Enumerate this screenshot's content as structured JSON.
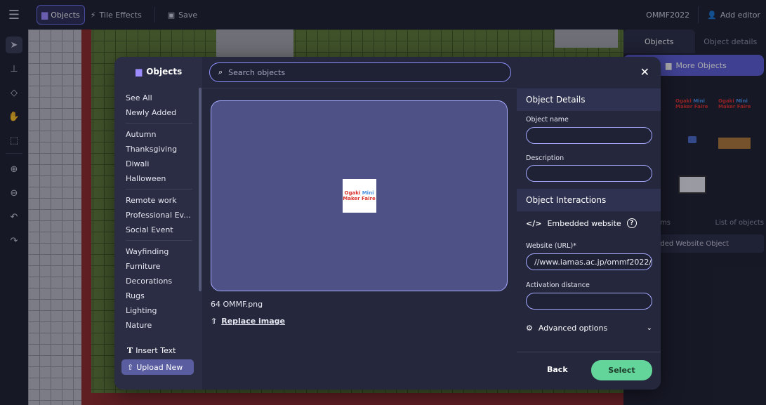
{
  "topbar": {
    "objects_label": "Objects",
    "tile_effects_label": "Tile Effects",
    "save_label": "Save",
    "room_name": "OMMF2022",
    "add_editor_label": "Add editor"
  },
  "right_panel": {
    "tabs": [
      "Objects",
      "Object details"
    ],
    "more_objects_label": "More Objects",
    "thumb_logo_line1a": "Ogaki ",
    "thumb_logo_line1b": "Mini",
    "thumb_logo_line2": "Maker Faire",
    "lower_tabs": [
      "ms",
      "List of objects"
    ],
    "list_item": "dded Website Object"
  },
  "modal": {
    "title": "Objects",
    "categories": [
      [
        "See All",
        "Newly Added"
      ],
      [
        "Autumn",
        "Thanksgiving",
        "Diwali",
        "Halloween"
      ],
      [
        "Remote work",
        "Professional Ev...",
        "Social Event"
      ],
      [
        "Wayfinding",
        "Furniture",
        "Decorations",
        "Rugs",
        "Lighting",
        "Nature"
      ]
    ],
    "insert_text_label": "Insert Text",
    "upload_new_label": "Upload New",
    "search_placeholder": "Search objects",
    "preview_logo_line1a": "Ogaki ",
    "preview_logo_line1b": "Mini",
    "preview_logo_line2": "Maker Faire",
    "file_name": "64 OMMF.png",
    "replace_image_label": "Replace image",
    "details": {
      "section_title": "Object Details",
      "object_name_label": "Object name",
      "object_name_value": "",
      "description_label": "Description",
      "description_value": "",
      "interactions_title": "Object Interactions",
      "interaction_type": "Embedded website",
      "url_label": "Website (URL)*",
      "url_value": "//www.iamas.ac.jp/ommf2022/",
      "activation_label": "Activation distance",
      "activation_value": "",
      "advanced_label": "Advanced options",
      "back_label": "Back",
      "select_label": "Select"
    }
  },
  "colors": {
    "accent": "#5c5fd6",
    "select_green": "#64d59a",
    "field_border": "#a6aaff"
  }
}
